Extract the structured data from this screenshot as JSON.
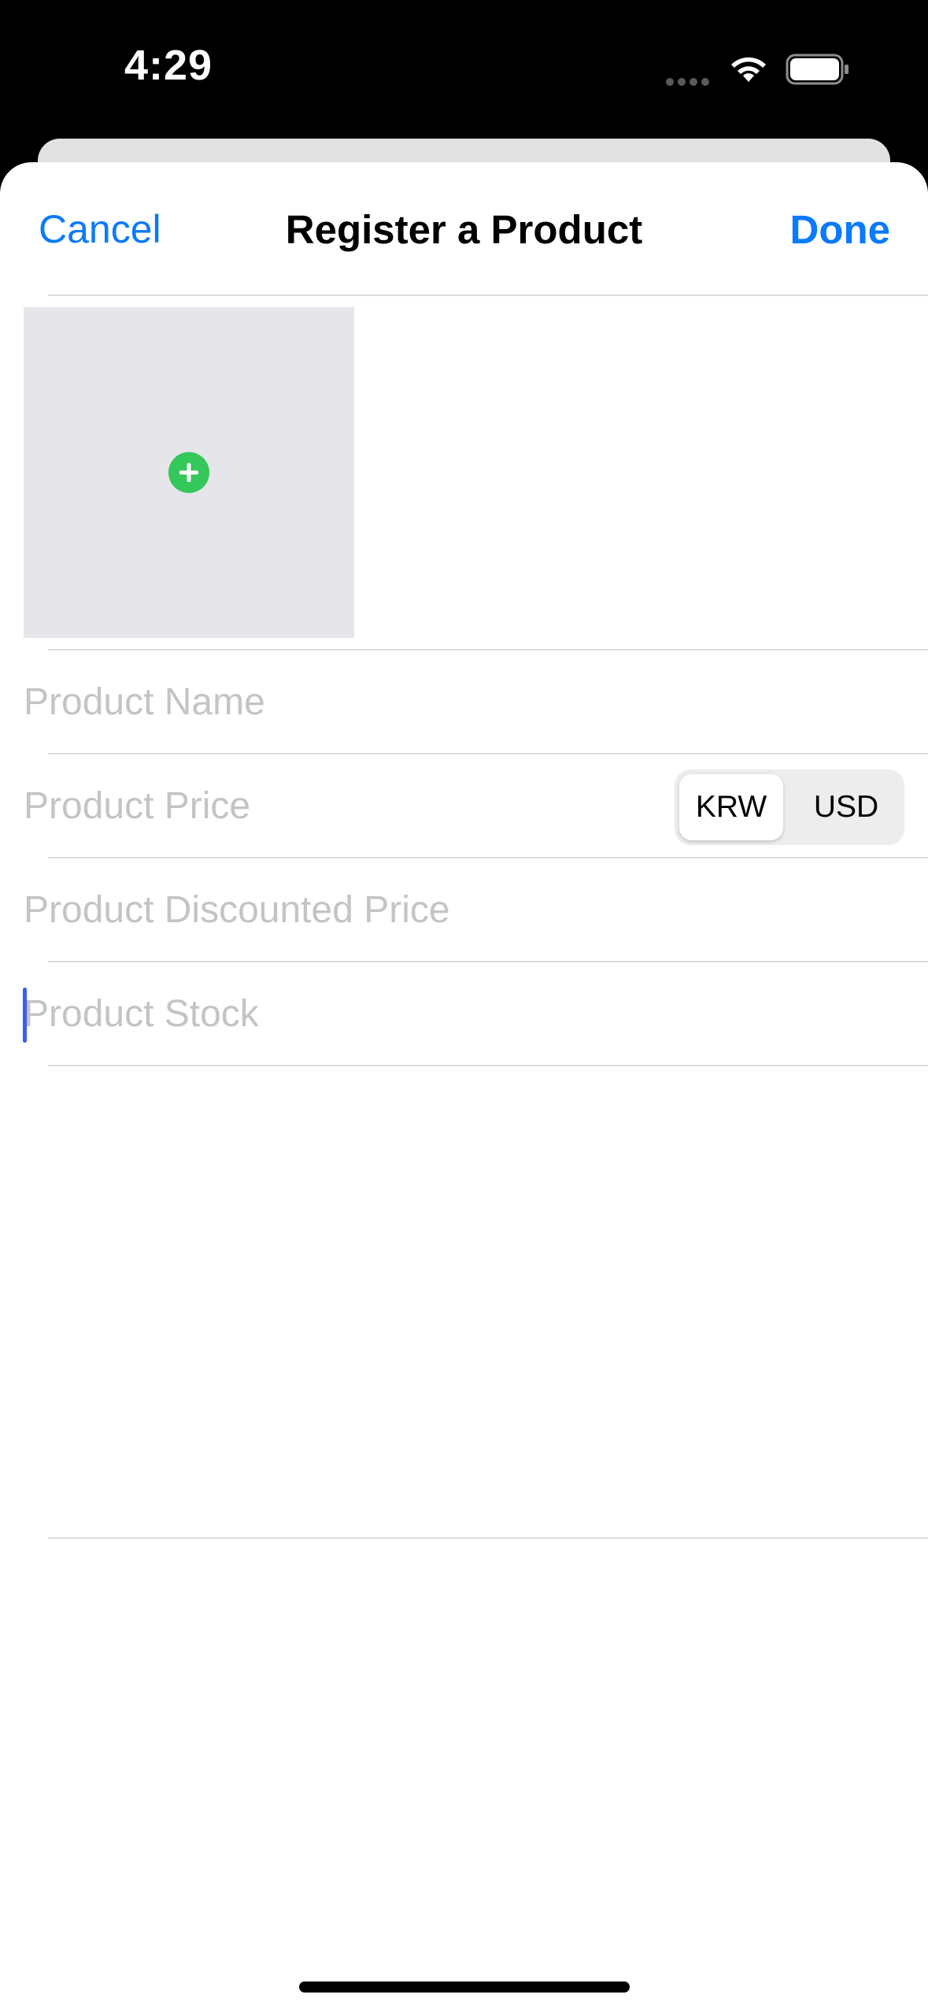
{
  "status_bar": {
    "time": "4:29"
  },
  "nav": {
    "cancel_label": "Cancel",
    "title": "Register a Product",
    "done_label": "Done"
  },
  "form": {
    "image_picker": {
      "icon": "plus-circle-icon",
      "icon_color": "#34c759"
    },
    "fields": [
      {
        "placeholder": "Product Name",
        "value": ""
      },
      {
        "placeholder": "Product Price",
        "value": ""
      },
      {
        "placeholder": "Product Discounted Price",
        "value": ""
      },
      {
        "placeholder": "Product Stock",
        "value": ""
      }
    ],
    "currency": {
      "options": [
        "KRW",
        "USD"
      ],
      "selected": "KRW"
    }
  },
  "colors": {
    "accent": "#0a7aff",
    "placeholder": "#c4c4c7",
    "caret": "#3a5ef2"
  }
}
